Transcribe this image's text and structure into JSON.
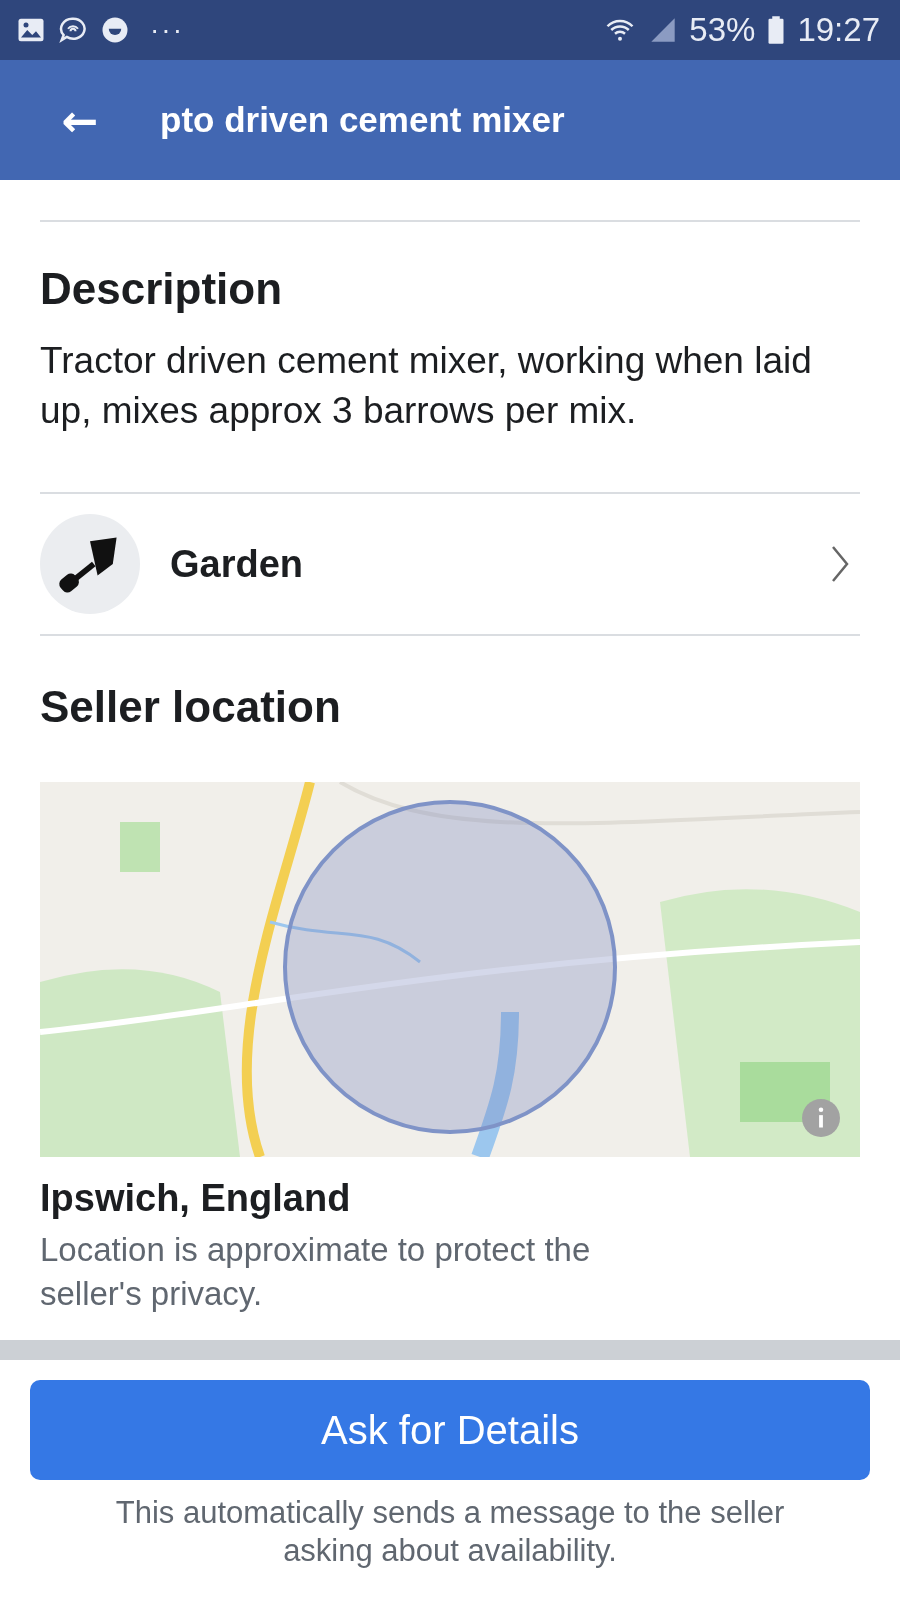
{
  "status_bar": {
    "dots": "···",
    "battery": "53%",
    "time": "19:27"
  },
  "header": {
    "back": "←",
    "title": "pto driven cement mixer"
  },
  "description": {
    "heading": "Description",
    "text": "Tractor driven cement mixer, working when laid up, mixes approx 3 barrows per mix."
  },
  "category": {
    "label": "Garden"
  },
  "seller_location": {
    "heading": "Seller location",
    "place": "Ipswich, England",
    "note": "Location is approximate to protect the seller's privacy."
  },
  "action": {
    "button": "Ask for Details",
    "note": "This automatically sends a message to the seller asking about availability."
  }
}
